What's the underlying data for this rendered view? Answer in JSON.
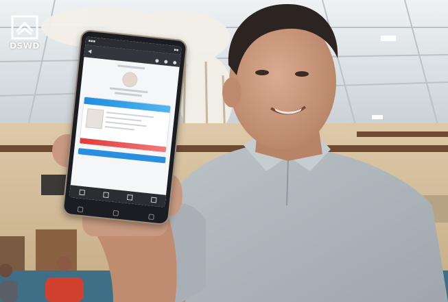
{
  "scene": {
    "logo": {
      "text": "DSWD",
      "icon": "dswd-house-hands-icon"
    },
    "colors": {
      "shirt": "#aeb6bb",
      "skin": "#c99a80",
      "ceiling": "#e6ebee",
      "wall": "#d9c5a6",
      "floor": "#3e6f86"
    }
  }
}
